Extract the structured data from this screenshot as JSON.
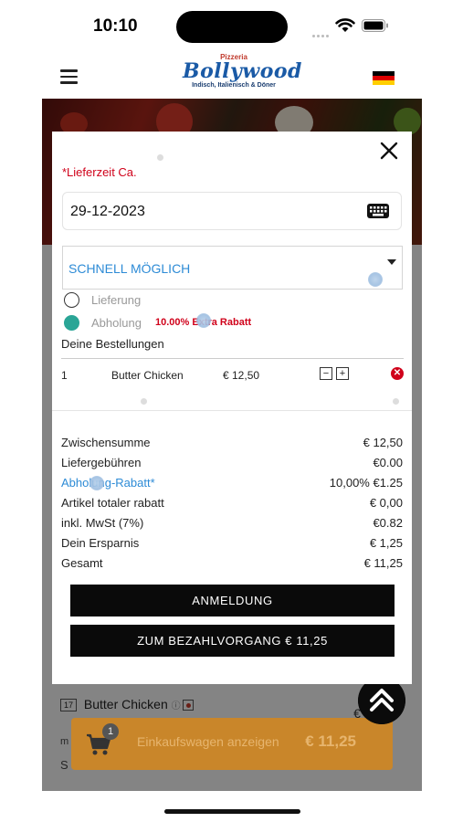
{
  "status_bar": {
    "time": "10:10"
  },
  "header": {
    "logo_top": "Pizzeria",
    "logo_main": "Bollywood",
    "logo_sub": "Indisch, Italienisch & Döner",
    "flag": "german-flag-icon"
  },
  "background": {
    "item_number": "17",
    "item_name": "Butter Chicken",
    "item_price": "€ 12,5",
    "row2_text": "m",
    "row3_text": "S"
  },
  "cart": {
    "count": "1",
    "label": "Einkaufswagen anzeigen",
    "total": "€ 11,25"
  },
  "modal": {
    "required_label": "*Lieferzeit Ca.",
    "date_value": "29-12-2023",
    "time_value": "SCHNELL MÖGLICH",
    "options": [
      {
        "label": "Lieferung",
        "selected": false
      },
      {
        "label": "Abholung",
        "selected": true,
        "note": "10.00% Extra Rabatt"
      }
    ],
    "orders_title": "Deine Bestellungen",
    "order_item": {
      "qty": "1",
      "name": "Butter Chicken",
      "price": "€ 12,50",
      "minus": "−",
      "plus": "+",
      "remove": "✕"
    },
    "summary": [
      {
        "label": "Zwischensumme",
        "value": "€ 12,50"
      },
      {
        "label": "Liefergebühren",
        "value": "€0.00"
      },
      {
        "label": "Abholung-Rabatt*",
        "value": "10,00% €1.25"
      },
      {
        "label": "Artikel totaler rabatt",
        "value": "€ 0,00"
      },
      {
        "label": "inkl. MwSt (7%)",
        "value": "€0.82"
      },
      {
        "label": "Dein Ersparnis",
        "value": "€ 1,25"
      },
      {
        "label": "Gesamt",
        "value": "€ 11,25"
      }
    ],
    "login_button": "ANMELDUNG",
    "checkout_button": "ZUM BEZAHLVORGANG € 11,25"
  },
  "colors": {
    "accent_blue": "#2d8bd6",
    "required_red": "#d0021b",
    "radio_teal": "#2aa596",
    "cart_orange": "#c9862a"
  }
}
